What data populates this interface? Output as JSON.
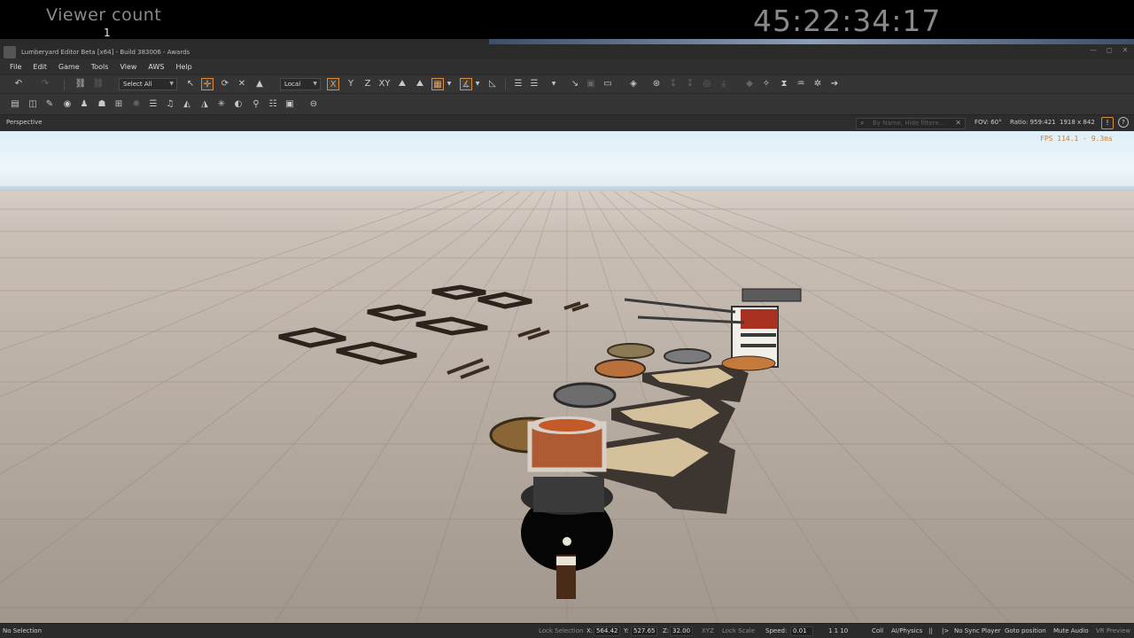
{
  "overlay": {
    "viewer_label": "Viewer count",
    "viewer_count": "1",
    "timer": "45:22:34:17"
  },
  "window": {
    "title": "Lumberyard Editor Beta [x64] - Build 383006 - Awards",
    "controls": [
      "—",
      "◻",
      "✕"
    ]
  },
  "menu": [
    "File",
    "Edit",
    "Game",
    "Tools",
    "View",
    "AWS",
    "Help"
  ],
  "toolbar": {
    "select_all": "Select All",
    "coord_space": "Local",
    "axis_x": "X",
    "axis_y": "Y",
    "axis_z": "Z",
    "axis_xy": "XY"
  },
  "viewport": {
    "name": "Perspective",
    "search_placeholder": "By Name, Hide filtere...",
    "fov": "FOV: 60°",
    "ratio": "Ratio: 959:421",
    "resolution": "1918 x 842",
    "fps": "FPS 114.1 - 9.3ms"
  },
  "status": {
    "selection": "No Selection",
    "lock_selection": "Lock Selection",
    "x_label": "X:",
    "x_value": "564.42",
    "y_label": "Y:",
    "y_value": "527.65",
    "z_label": "Z:",
    "z_value": "32.00",
    "xyz": "XYZ",
    "lock_scale": "Lock Scale",
    "speed_label": "Speed:",
    "speed_value": "0.01",
    "steps": "1  1  10",
    "coll": "Coll",
    "ai_physics": "AI/Physics",
    "pause": "||",
    "play": "|>",
    "sync_player": "No Sync Player",
    "goto_position": "Goto position",
    "mute_audio": "Mute Audio",
    "vr_preview": "VR Preview"
  },
  "colors": {
    "accent": "#d98b3a",
    "fps_text": "#c0813d",
    "sky": "#e6f2f7",
    "ground": "#c9bfb4"
  }
}
